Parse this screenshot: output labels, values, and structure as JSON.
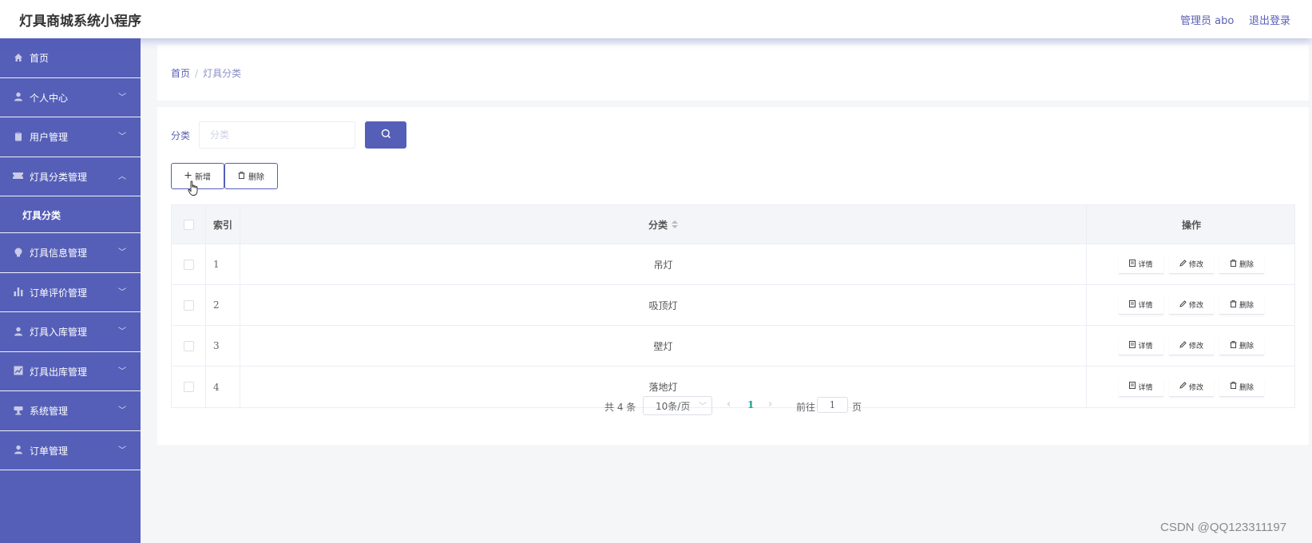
{
  "app": {
    "title": "灯具商城系统小程序",
    "user_label": "管理员 abo",
    "logout_label": "退出登录"
  },
  "sidebar": {
    "items": [
      {
        "label": "首页",
        "icon": "home-icon",
        "expandable": false
      },
      {
        "label": "个人中心",
        "icon": "user-icon",
        "expandable": true,
        "expanded": false
      },
      {
        "label": "用户管理",
        "icon": "clipboard-icon",
        "expandable": true,
        "expanded": false
      },
      {
        "label": "灯具分类管理",
        "icon": "ticket-icon",
        "expandable": true,
        "expanded": true
      },
      {
        "label": "灯具分类",
        "submenu": true
      },
      {
        "label": "灯具信息管理",
        "icon": "bulb-icon",
        "expandable": true,
        "expanded": false
      },
      {
        "label": "订单评价管理",
        "icon": "bar-chart-icon",
        "expandable": true,
        "expanded": false
      },
      {
        "label": "灯具入库管理",
        "icon": "user-icon",
        "expandable": true,
        "expanded": false
      },
      {
        "label": "灯具出库管理",
        "icon": "line-chart-icon",
        "expandable": true,
        "expanded": false
      },
      {
        "label": "系统管理",
        "icon": "cup-icon",
        "expandable": true,
        "expanded": false
      },
      {
        "label": "订单管理",
        "icon": "user-icon",
        "expandable": true,
        "expanded": false
      }
    ]
  },
  "breadcrumb": {
    "home": "首页",
    "separator": "/",
    "current": "灯具分类"
  },
  "search": {
    "label": "分类",
    "placeholder": "分类",
    "value": ""
  },
  "toolbar": {
    "add_label": "新增",
    "delete_label": "删除"
  },
  "table": {
    "headers": {
      "index": "索引",
      "category": "分类",
      "operations": "操作"
    },
    "rows": [
      {
        "index": "1",
        "category": "吊灯"
      },
      {
        "index": "2",
        "category": "吸顶灯"
      },
      {
        "index": "3",
        "category": "壁灯"
      },
      {
        "index": "4",
        "category": "落地灯"
      }
    ],
    "row_actions": {
      "detail": "详情",
      "edit": "修改",
      "delete": "删除"
    }
  },
  "pagination": {
    "total_text": "共 4 条",
    "page_size": "10条/页",
    "current_page": "1",
    "goto_label": "前往",
    "goto_value": "1",
    "page_suffix": "页"
  },
  "watermark": "CSDN @QQ123311197",
  "colors": {
    "primary": "#555fb8",
    "active_page": "#13a58a",
    "header_text": "#5a5fb4"
  }
}
